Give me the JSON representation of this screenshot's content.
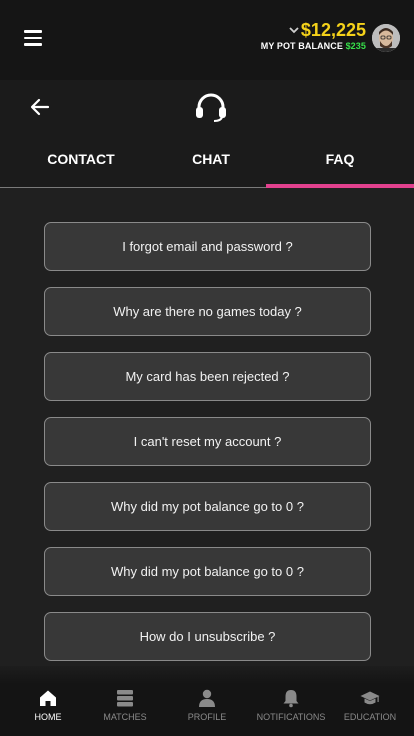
{
  "topbar": {
    "balance_amount": "$12,225",
    "pot_label": "MY POT BALANCE",
    "pot_value": "$235"
  },
  "tabs": [
    {
      "label": "CONTACT"
    },
    {
      "label": "CHAT"
    },
    {
      "label": "FAQ"
    }
  ],
  "active_tab": "FAQ",
  "faq": [
    {
      "question": "I forgot email and password ?"
    },
    {
      "question": "Why are there no games today ?"
    },
    {
      "question": "My card has been rejected ?"
    },
    {
      "question": "I can't reset my account ?"
    },
    {
      "question": "Why did my pot balance go to 0 ?"
    },
    {
      "question": "Why did my pot balance go to 0 ?"
    },
    {
      "question": "How do I unsubscribe ?"
    }
  ],
  "bottom_nav": [
    {
      "label": "HOME",
      "icon": "home-icon"
    },
    {
      "label": "MATCHES",
      "icon": "matches-icon"
    },
    {
      "label": "PROFILE",
      "icon": "profile-icon"
    },
    {
      "label": "NOTIFICATIONS",
      "icon": "bell-icon"
    },
    {
      "label": "EDUCATION",
      "icon": "graduation-cap-icon"
    }
  ],
  "colors": {
    "balance": "#f5d21a",
    "pot_value": "#37e04a",
    "active_tab_underline": "#e2418e"
  }
}
